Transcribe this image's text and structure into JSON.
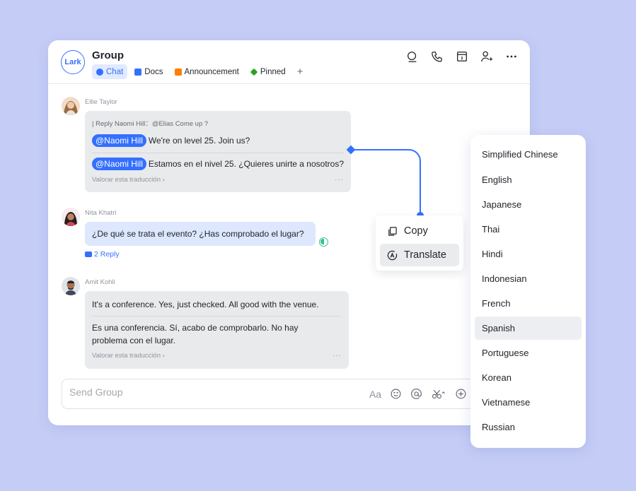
{
  "app": {
    "logo_text": "Lark",
    "group_title": "Group"
  },
  "tabs": [
    {
      "label": "Chat",
      "active": true,
      "icon": "chat-bubble-icon"
    },
    {
      "label": "Docs",
      "active": false,
      "icon": "docs-icon"
    },
    {
      "label": "Announcement",
      "active": false,
      "icon": "megaphone-icon"
    },
    {
      "label": "Pinned",
      "active": false,
      "icon": "pin-icon"
    }
  ],
  "tab_add": "+",
  "header_icons": [
    "search-icon",
    "phone-icon",
    "calendar-icon",
    "add-member-icon",
    "more-icon"
  ],
  "messages": [
    {
      "sender": "Ellie Taylor",
      "reply_quote": "| Reply Naomi Hill：@Elias Come up ?",
      "mention": "@Naomi Hill",
      "text": "We're on level 25. Join us?",
      "translation_mention": "@Naomi Hill",
      "translation": "Estamos en el nivel 25. ¿Quieres unirte a nosotros?",
      "rate_link": "Valorar esta traducción",
      "more": "···"
    },
    {
      "sender": "Nita Khatri",
      "text": "¿De qué se trata el evento? ¿Has comprobado el lugar?",
      "reply_count": "2 Reply"
    },
    {
      "sender": "Amit Kohli",
      "text": "It's a conference. Yes, just checked. All good with the venue.",
      "translation_line1": "Es una conferencia. Sí, acabo de comprobarlo. No hay",
      "translation_line2": "problema con el lugar.",
      "rate_link": "Valorar esta traducción",
      "more": "···"
    }
  ],
  "input": {
    "placeholder": "Send Group",
    "font_tool": "Aa"
  },
  "context_menu": [
    {
      "label": "Copy",
      "icon": "copy-icon"
    },
    {
      "label": "Translate",
      "icon": "translate-icon",
      "selected": true
    }
  ],
  "languages": [
    "Simplified Chinese",
    "English",
    "Japanese",
    "Thai",
    "Hindi",
    "Indonesian",
    "French",
    "Spanish",
    "Portuguese",
    "Korean",
    "Vietnamese",
    "Russian"
  ],
  "selected_language": "Spanish",
  "colors": {
    "accent": "#3370ff",
    "background": "#c5cdf6",
    "bubble": "#e9eaec"
  }
}
